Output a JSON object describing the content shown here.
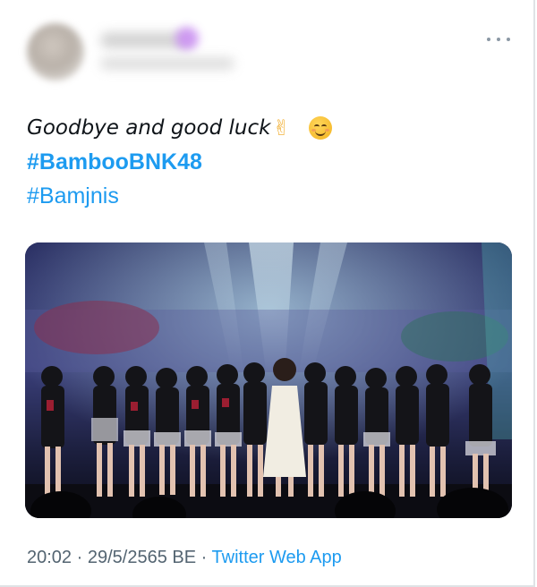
{
  "tweet": {
    "text_line": "Goodbye and good luck",
    "emojis": [
      "victory-hand",
      "smiling-face"
    ],
    "hashtags": [
      "#BambooBNK48",
      "#Bamjnis"
    ],
    "media": {
      "type": "photo",
      "content": "group-on-stage-concert"
    },
    "time": "20:02",
    "date": "29/5/2565 BE",
    "separator": "·",
    "source": "Twitter Web App"
  },
  "colors": {
    "link": "#1d9bf0",
    "meta": "#536471",
    "text": "#0f1419",
    "divider": "#dfe3e6"
  },
  "icons": {
    "more": "more-horizontal-icon"
  }
}
